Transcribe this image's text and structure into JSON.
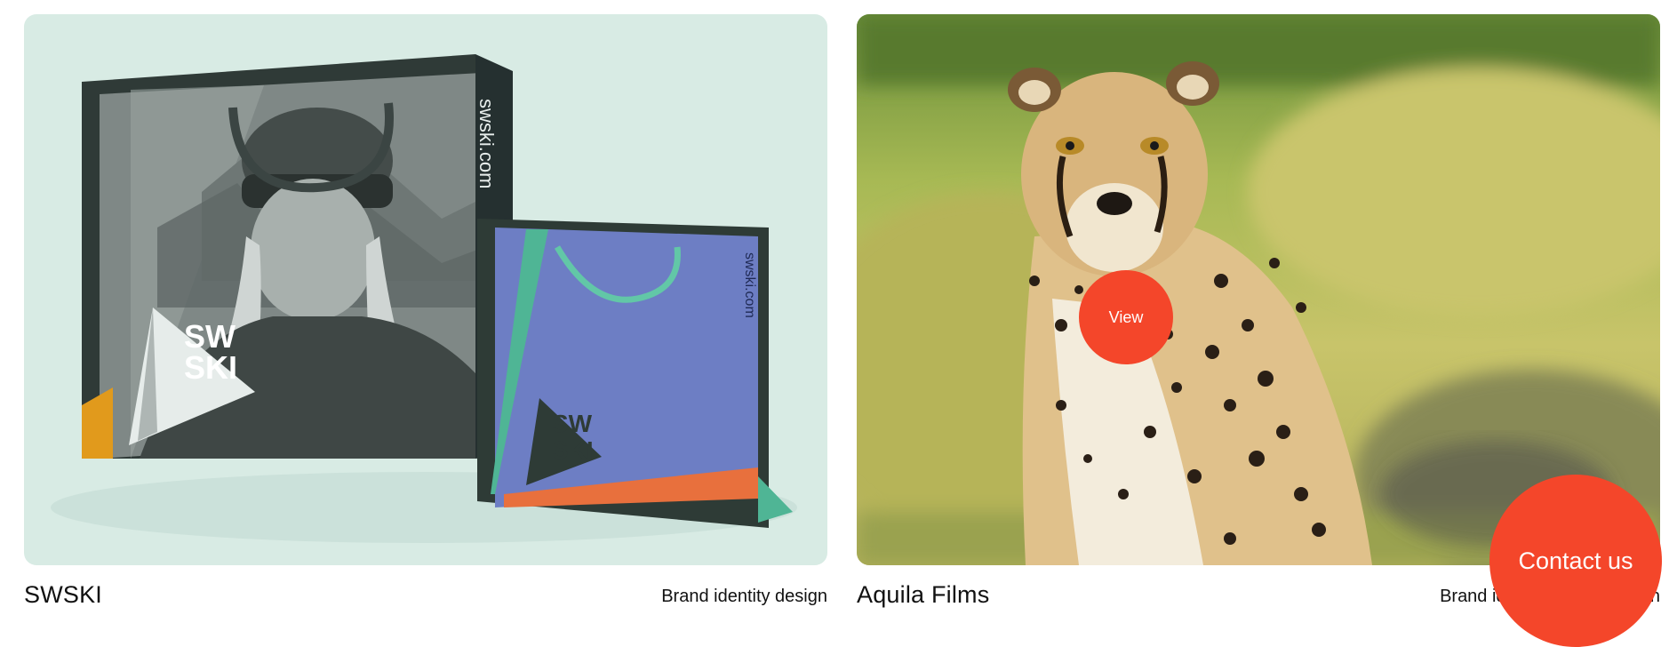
{
  "projects": [
    {
      "title": "SWSKI",
      "tag": "Brand identity design",
      "bag_large_url": "swski.com",
      "bag_small_url": "swski.com",
      "logo_line1": "SW",
      "logo_line2": "SKI",
      "colors": {
        "background": "#d8ebe4",
        "bag_dark": "#2e3b36",
        "bag_blue": "#6d7ec4",
        "accent_teal": "#4fb595",
        "accent_orange": "#e8703d",
        "accent_yellow": "#e19a1c"
      }
    },
    {
      "title": "Aquila Films",
      "tag": "Brand identity & web design",
      "view_label": "View"
    }
  ],
  "contact_label": "Contact us",
  "accent_color": "#f4462a"
}
